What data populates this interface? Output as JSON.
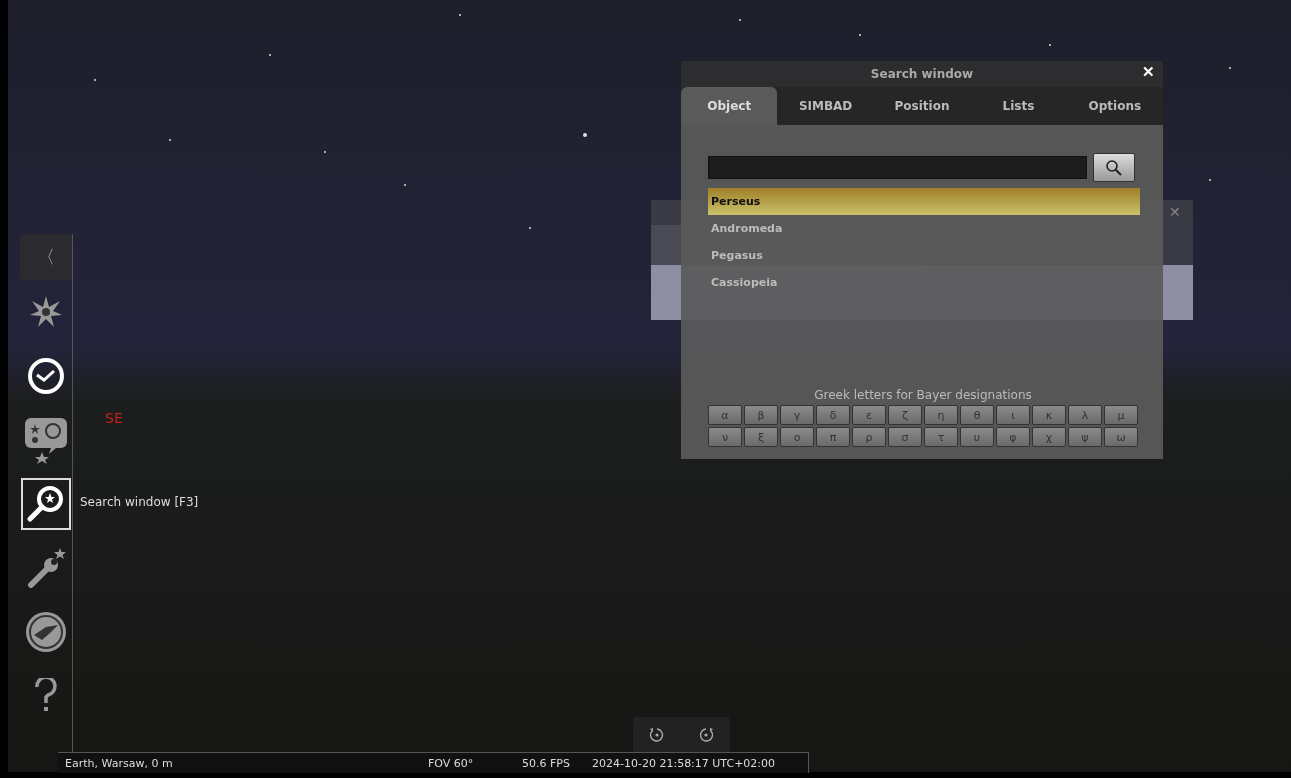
{
  "sky": {
    "compass_label": "SE"
  },
  "sidebar": {
    "collapse_glyph": "〈",
    "items": [
      {
        "kind": "sky",
        "on": false,
        "highlighted": false
      },
      {
        "kind": "clock",
        "on": true,
        "highlighted": false
      },
      {
        "kind": "objects",
        "on": false,
        "highlighted": false
      },
      {
        "kind": "search",
        "on": true,
        "highlighted": true
      },
      {
        "kind": "config",
        "on": false,
        "highlighted": false
      },
      {
        "kind": "logo",
        "on": false,
        "highlighted": false
      },
      {
        "kind": "help",
        "on": false,
        "highlighted": false
      }
    ],
    "tooltip": "Search window  [F3]"
  },
  "date_window": {
    "close": "✕"
  },
  "search_window": {
    "title": "Search window",
    "close": "✕",
    "tabs": [
      {
        "label": "Object",
        "selected": true
      },
      {
        "label": "SIMBAD",
        "selected": false
      },
      {
        "label": "Position",
        "selected": false
      },
      {
        "label": "Lists",
        "selected": false
      },
      {
        "label": "Options",
        "selected": false
      }
    ],
    "results": [
      {
        "label": "Perseus",
        "selected": true
      },
      {
        "label": "Andromeda",
        "selected": false
      },
      {
        "label": "Pegasus",
        "selected": false
      },
      {
        "label": "Cassiopeia",
        "selected": false
      }
    ],
    "greek_label": "Greek letters for Bayer designations",
    "greek_keys": [
      [
        "α",
        "β",
        "γ",
        "δ",
        "ε",
        "ζ",
        "η",
        "θ",
        "ι",
        "κ",
        "λ",
        "μ"
      ],
      [
        "ν",
        "ξ",
        "ο",
        "π",
        "ρ",
        "σ",
        "τ",
        "υ",
        "φ",
        "χ",
        "ψ",
        "ω"
      ]
    ]
  },
  "rotation_buttons": [
    {
      "kind": "ccw"
    },
    {
      "kind": "cw"
    }
  ],
  "status_bar": {
    "location": "Earth, Warsaw, 0 m",
    "fov": "FOV 60°",
    "fps": "50.6 FPS",
    "datetime": "2024-10-20 21:58:17 UTC+02:00"
  }
}
